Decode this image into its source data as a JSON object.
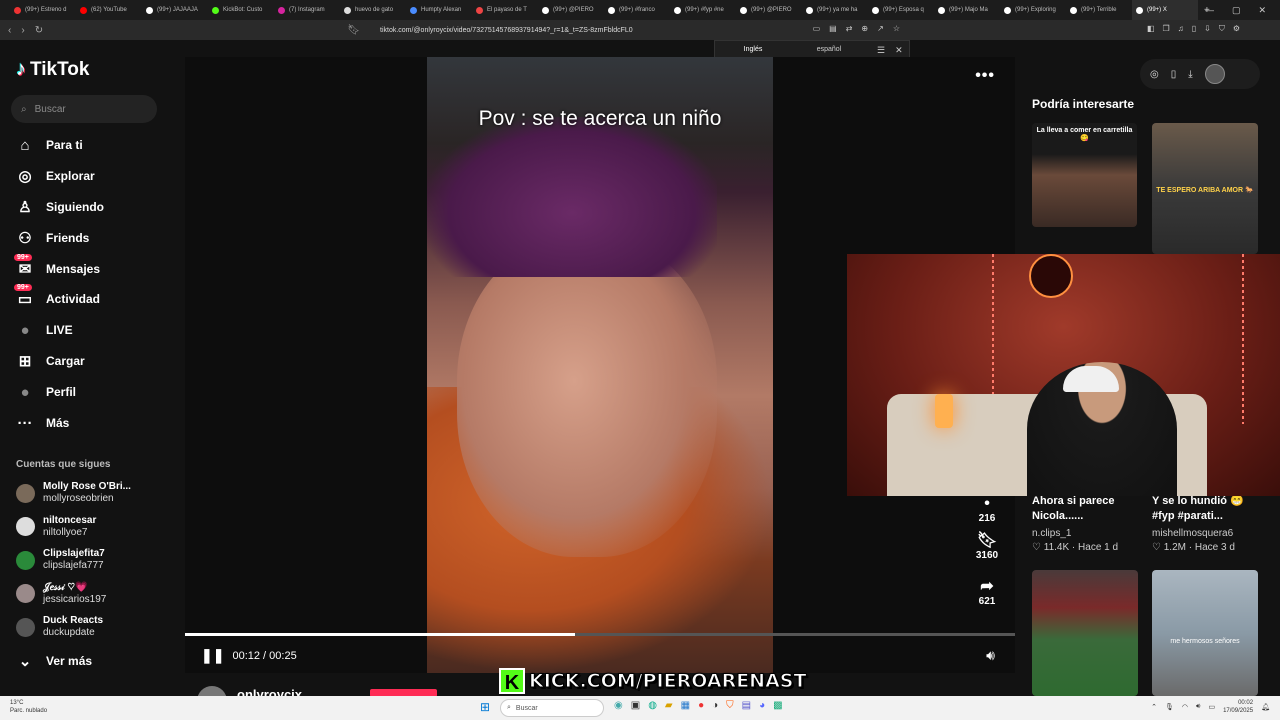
{
  "browser": {
    "tabs": [
      {
        "label": "(99+) Estreno d",
        "color": "#e33"
      },
      {
        "label": "(62) YouTube",
        "color": "#f00"
      },
      {
        "label": "(99+) JAJAAJA",
        "color": "#fff"
      },
      {
        "label": "KickBot: Custo",
        "color": "#53fc18"
      },
      {
        "label": "(7) Instagram",
        "color": "#d6249f"
      },
      {
        "label": "huevo de gato",
        "color": "#ddd"
      },
      {
        "label": "Humpty Alexan",
        "color": "#4a8cff"
      },
      {
        "label": "El payaso de T",
        "color": "#e44"
      },
      {
        "label": "(99+) @PIERO",
        "color": "#fff"
      },
      {
        "label": "(99+) #franco",
        "color": "#fff"
      },
      {
        "label": "(99+) #fyp #ne",
        "color": "#fff"
      },
      {
        "label": "(99+) @PIERO",
        "color": "#fff"
      },
      {
        "label": "(99+) ya me ha",
        "color": "#fff"
      },
      {
        "label": "(99+) Esposa q",
        "color": "#fff"
      },
      {
        "label": "(99+) Majo Ma",
        "color": "#fff"
      },
      {
        "label": "(99+) Exploring",
        "color": "#fff"
      },
      {
        "label": "(99+) Terrible",
        "color": "#fff"
      },
      {
        "label": "(99+) X",
        "color": "#fff"
      }
    ],
    "url": "tiktok.com/@onlyroycix/video/7327514576893791494?_r=1&_t=ZS-8zmFbldcFL0",
    "translate": {
      "lang1": "Inglés",
      "lang2": "español"
    }
  },
  "sidebar": {
    "logo": "TikTok",
    "search_placeholder": "Buscar",
    "nav": [
      {
        "label": "Para ti",
        "icon": "home-icon",
        "glyph": "⌂"
      },
      {
        "label": "Explorar",
        "icon": "compass-icon",
        "glyph": "◎"
      },
      {
        "label": "Siguiendo",
        "icon": "person-icon",
        "glyph": "♙"
      },
      {
        "label": "Friends",
        "icon": "people-icon",
        "glyph": "⚇"
      },
      {
        "label": "Mensajes",
        "icon": "message-icon",
        "glyph": "✉",
        "badge": "99+"
      },
      {
        "label": "Actividad",
        "icon": "inbox-icon",
        "glyph": "▭",
        "badge": "99+"
      },
      {
        "label": "LIVE",
        "icon": "live-icon",
        "glyph": "●"
      },
      {
        "label": "Cargar",
        "icon": "upload-icon",
        "glyph": "⊞"
      },
      {
        "label": "Perfil",
        "icon": "profile-icon",
        "glyph": "●"
      },
      {
        "label": "Más",
        "icon": "more-icon",
        "glyph": "···"
      }
    ],
    "following_title": "Cuentas que sigues",
    "following": [
      {
        "name": "Molly Rose O'Bri...",
        "handle": "mollyroseobrien"
      },
      {
        "name": "niltoncesar",
        "handle": "niltollyoe7"
      },
      {
        "name": "Clipslajefita7",
        "handle": "clipslajefa777"
      },
      {
        "name": "𝒥𝑒𝓈𝓈𝒾 ♡💗",
        "handle": "jessicarios197"
      },
      {
        "name": "Duck Reacts",
        "handle": "duckupdate"
      }
    ],
    "see_more": "Ver más"
  },
  "video": {
    "caption": "Pov : se te acerca un niño",
    "time": "00:12 / 00:25",
    "progress": 0.47,
    "author": "onlyroycix",
    "actions": {
      "comments": "216",
      "saves": "3160",
      "shares": "621"
    }
  },
  "recommendations": {
    "title": "Podría interesarte",
    "items": [
      {
        "thumb_label": "La lleva a comer en carretilla 😋"
      },
      {
        "thumb_label": "TE ESPERO ARIBA AMOR 🐎"
      },
      {
        "text": "Ahora si parece Nicola......",
        "user": "n.clips_1",
        "likes": "11.4K",
        "ago": "Hace 1 d"
      },
      {
        "text": "Y se lo hundió 😁 #fyp #parati...",
        "user": "mishellmosquera6",
        "likes": "1.2M",
        "ago": "Hace 3 d"
      },
      {
        "thumb_label": ""
      },
      {
        "thumb_label": "me hermosos señores"
      }
    ]
  },
  "overlay": {
    "kick": "KICK.COM/PIEROARENAST",
    "kick_letter": "K"
  },
  "taskbar": {
    "weather_temp": "13°C",
    "weather_desc": "Parc. nublado",
    "search": "Buscar",
    "time": "00:02",
    "date": "17/09/2025"
  }
}
